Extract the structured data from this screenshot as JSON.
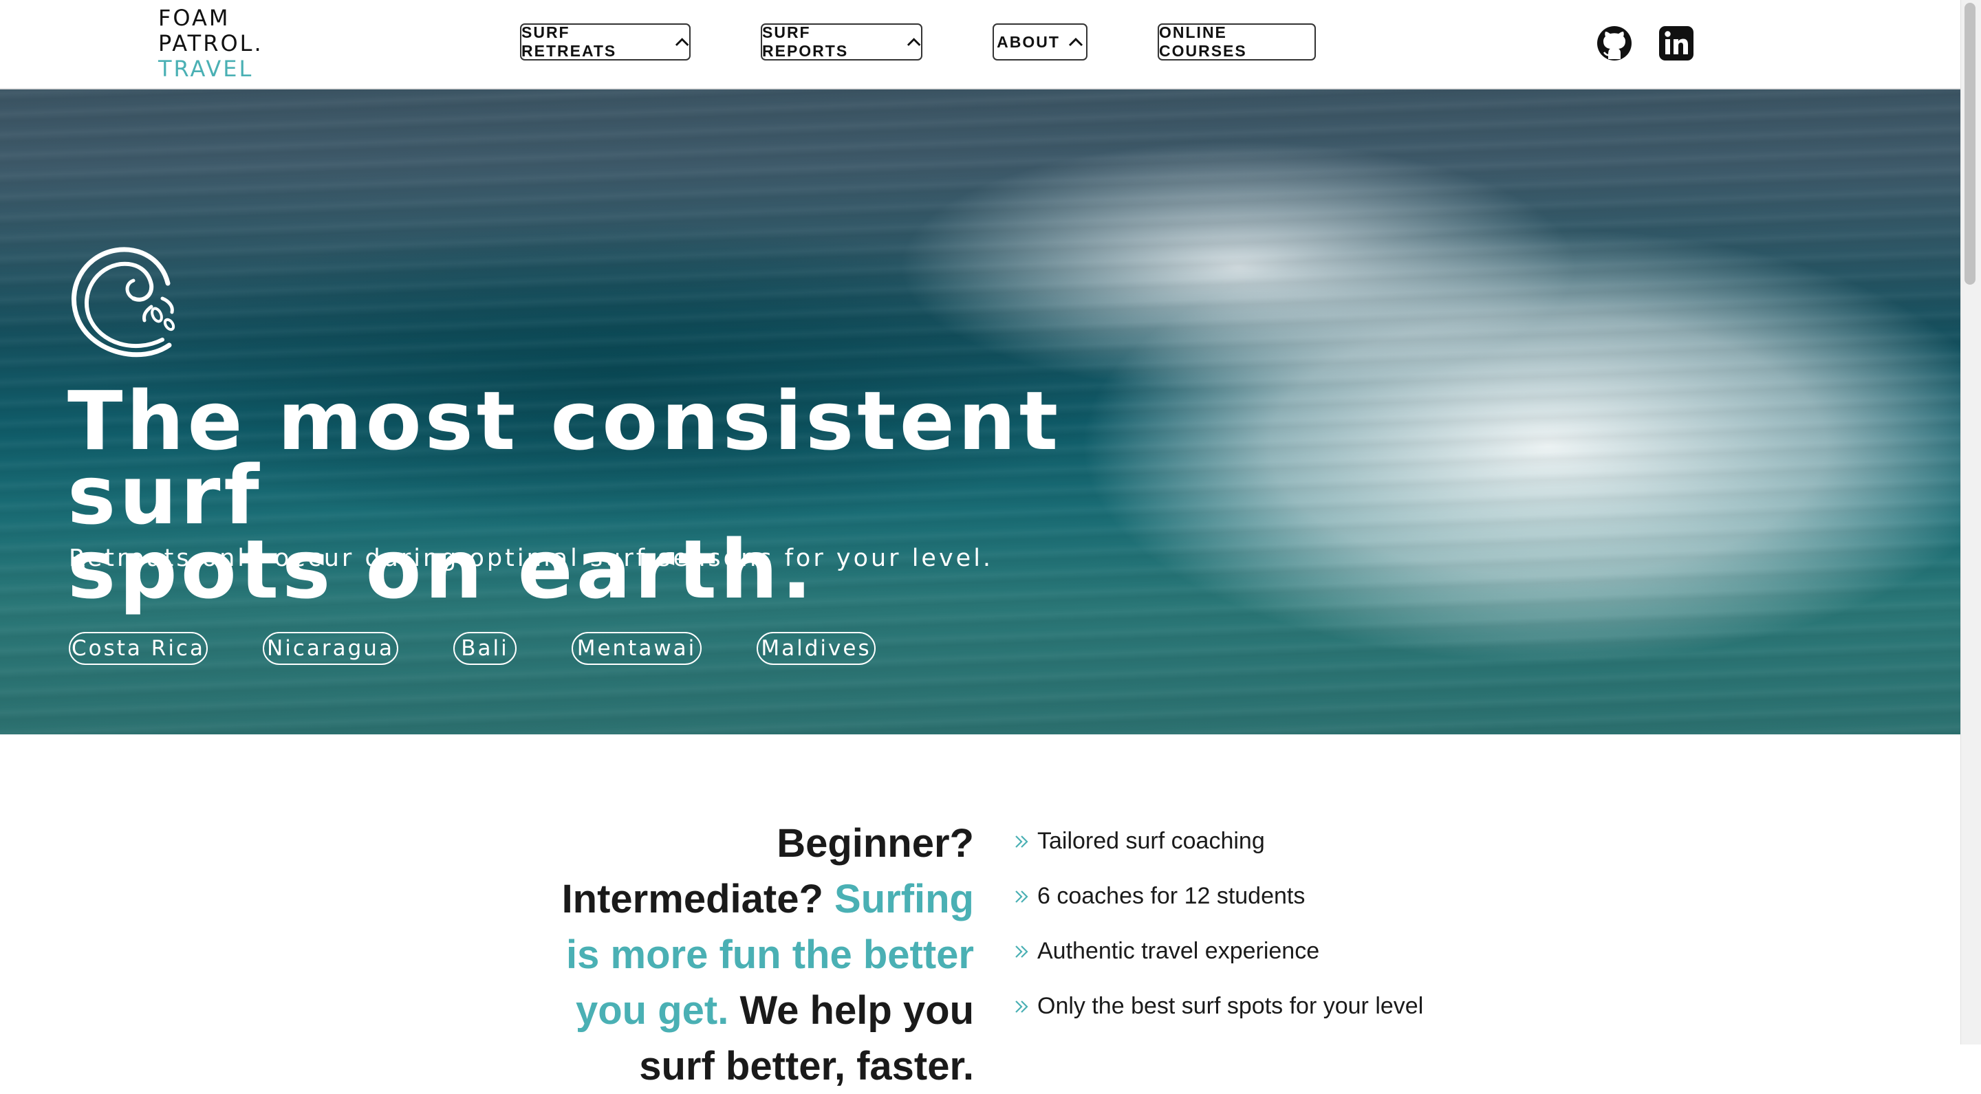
{
  "header": {
    "logo": {
      "line1": "FOAM",
      "line2": "PATROL.",
      "line3": "TRAVEL"
    },
    "nav": [
      {
        "label": "SURF RETREATS",
        "icon": "chevron-up-icon"
      },
      {
        "label": "SURF REPORTS",
        "icon": "chevron-up-icon"
      },
      {
        "label": "ABOUT",
        "icon": "chevron-up-icon"
      },
      {
        "label": "ONLINE COURSES"
      }
    ],
    "social": [
      "github-icon",
      "linkedin-icon"
    ]
  },
  "hero": {
    "icon": "wave-logo-icon",
    "headline_line1": "The most consistent surf",
    "headline_line2": "spots on earth.",
    "subheadline": "Retreats only occur during optimal surf seasons for your level.",
    "destinations": [
      "Costa Rica",
      "Nicaragua",
      "Bali",
      "Mentawai",
      "Maldives"
    ]
  },
  "pitch": {
    "part1": "Beginner? Intermediate?",
    "accent": "Surfing is more fun the better you get.",
    "part2": "We help you surf better, faster."
  },
  "features": [
    "Tailored surf coaching",
    "6 coaches for 12 students",
    "Authentic travel experience",
    "Only the best surf spots for your level"
  ],
  "colors": {
    "accent": "#4ab0b4",
    "text": "#1a1a1a",
    "hero_text": "#ffffff",
    "ocean": "#15505e"
  }
}
